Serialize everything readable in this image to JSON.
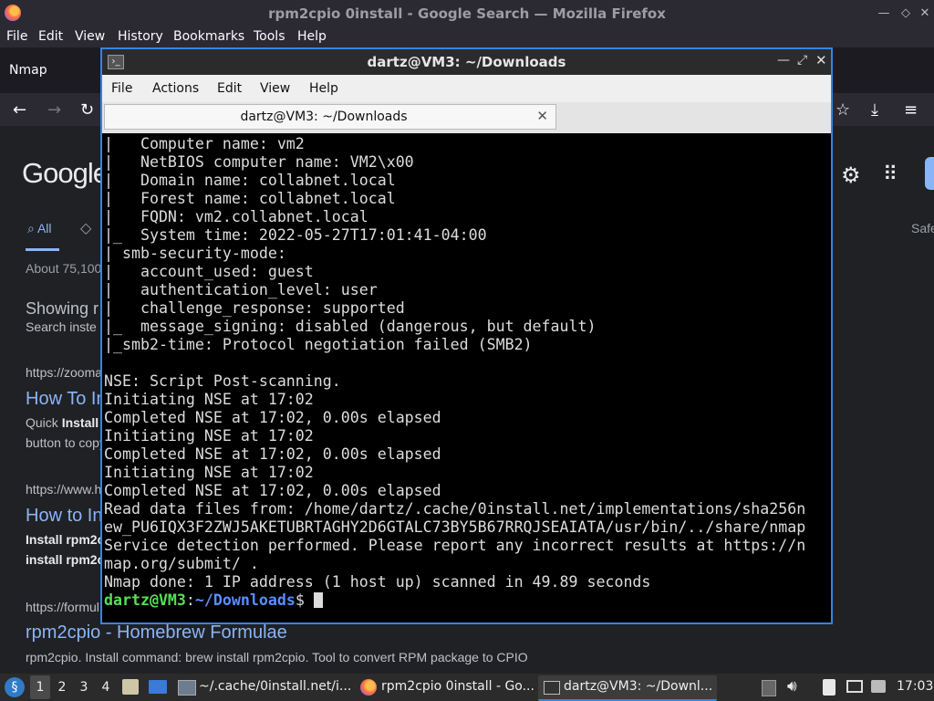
{
  "firefox": {
    "window_title": "rpm2cpio 0install - Google Search — Mozilla Firefox",
    "menu": [
      "File",
      "Edit",
      "View",
      "History",
      "Bookmarks",
      "Tools",
      "Help"
    ],
    "tab_label": "Nmap",
    "page": {
      "logo": "Google",
      "tab_all": "All",
      "safe": "Safe",
      "result_count": "About 75,100",
      "showing": "Showing r",
      "search_instead": "Search inste",
      "results": [
        {
          "url": "https://zooma",
          "title": "How To In",
          "snippet1_bold": "Install",
          "snippet1_pre": "Quick ",
          "snippet2": "button to copy"
        },
        {
          "url": "https://www.h",
          "title": "How to In",
          "snippet1": "Install rpm2c",
          "snippet2": "install rpm2c"
        },
        {
          "url": "https://formul",
          "title": "rpm2cpio - Homebrew Formulae",
          "snippet": "rpm2cpio. Install command: brew install rpm2cpio. Tool to convert RPM package to CPIO"
        }
      ]
    }
  },
  "terminal": {
    "title": "dartz@VM3: ~/Downloads",
    "menu": [
      "File",
      "Actions",
      "Edit",
      "View",
      "Help"
    ],
    "tab_label": "dartz@VM3: ~/Downloads",
    "lines": [
      "|   Computer name: vm2",
      "|   NetBIOS computer name: VM2\\x00",
      "|   Domain name: collabnet.local",
      "|   Forest name: collabnet.local",
      "|   FQDN: vm2.collabnet.local",
      "|_  System time: 2022-05-27T17:01:41-04:00",
      "| smb-security-mode:",
      "|   account_used: guest",
      "|   authentication_level: user",
      "|   challenge_response: supported",
      "|_  message_signing: disabled (dangerous, but default)",
      "|_smb2-time: Protocol negotiation failed (SMB2)",
      "",
      "NSE: Script Post-scanning.",
      "Initiating NSE at 17:02",
      "Completed NSE at 17:02, 0.00s elapsed",
      "Initiating NSE at 17:02",
      "Completed NSE at 17:02, 0.00s elapsed",
      "Initiating NSE at 17:02",
      "Completed NSE at 17:02, 0.00s elapsed",
      "Read data files from: /home/dartz/.cache/0install.net/implementations/sha256n",
      "ew_PU6IQX3F2ZWJ5AKETUBRTAGHY2D6GTALC73BY5B67RRQJSEAIATA/usr/bin/../share/nmap",
      "Service detection performed. Please report any incorrect results at https://n",
      "map.org/submit/ .",
      "Nmap done: 1 IP address (1 host up) scanned in 49.89 seconds"
    ],
    "prompt_user": "dartz@VM3",
    "prompt_sep": ":",
    "prompt_path": "~/Downloads",
    "prompt_end": "$ "
  },
  "taskbar": {
    "workspaces": [
      "1",
      "2",
      "3",
      "4"
    ],
    "tasks": [
      "~/.cache/0install.net/i...",
      "rpm2cpio 0install - Go...",
      "dartz@VM3: ~/Downl..."
    ],
    "clock": "17:03"
  }
}
